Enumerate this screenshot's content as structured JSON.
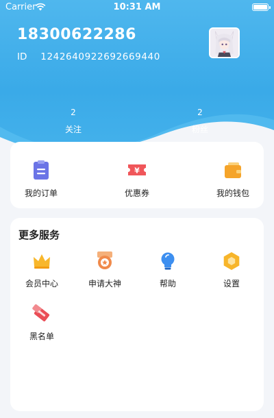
{
  "status_bar": {
    "carrier": "Carrier",
    "time": "10:31 AM",
    "icons": [
      "wifi-icon",
      "battery-icon"
    ]
  },
  "profile": {
    "phone": "18300622286",
    "id_label": "ID",
    "id_value": "1242640922692669440",
    "avatar": "anime-avatar"
  },
  "stats": {
    "follow": {
      "count": "2",
      "label": "关注"
    },
    "fans": {
      "count": "2",
      "label": "粉丝"
    }
  },
  "orders": [
    {
      "label": "我的订单",
      "icon": "clipboard-icon",
      "color": "#6b74e6"
    },
    {
      "label": "优惠券",
      "icon": "coupon-icon",
      "color": "#f0565a"
    },
    {
      "label": "我的钱包",
      "icon": "wallet-icon",
      "color": "#f5a42a"
    }
  ],
  "services": {
    "title": "更多服务",
    "items": [
      {
        "label": "会员中心",
        "icon": "crown-icon",
        "color": "#f8b72c"
      },
      {
        "label": "申请大神",
        "icon": "medal-icon",
        "color": "#f08a4b"
      },
      {
        "label": "帮助",
        "icon": "lightbulb-icon",
        "color": "#3d8ff0"
      },
      {
        "label": "设置",
        "icon": "settings-hexagon-icon",
        "color": "#f7b52a"
      },
      {
        "label": "黑名单",
        "icon": "blacklist-icon",
        "color": "#ea4d56"
      }
    ]
  },
  "colors": {
    "header_blue": "#3aaae8",
    "background": "#f3f5f9"
  }
}
